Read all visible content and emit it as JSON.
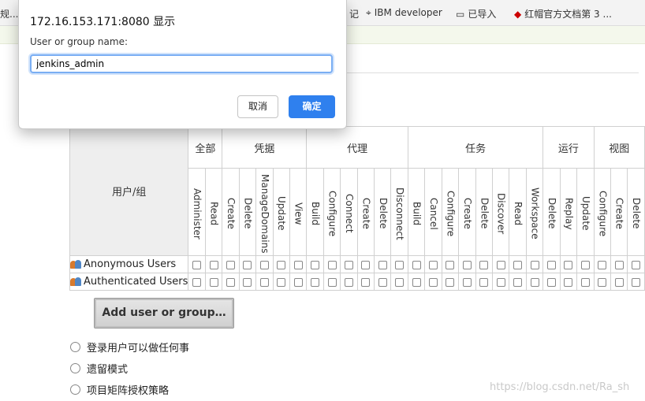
{
  "bookmarks": [
    {
      "text": "规...",
      "icon": ""
    },
    {
      "text": "记",
      "icon": ""
    },
    {
      "text": "IBM developer",
      "icon": "ibm-logo-icon"
    },
    {
      "text": "已导入",
      "icon": "folder-icon"
    },
    {
      "text": "红帽官方文档第 3 ...",
      "icon": "redhat-logo-icon"
    }
  ],
  "dialog": {
    "title": "172.16.153.171:8080 显示",
    "label": "User or group name:",
    "input_value": "jenkins_admin",
    "cancel_label": "取消",
    "ok_label": "确定"
  },
  "matrix": {
    "corner_label": "用户/组",
    "groups": [
      {
        "label": "全部",
        "permissions": [
          "Administer",
          "Read"
        ]
      },
      {
        "label": "凭据",
        "permissions": [
          "Create",
          "Delete",
          "ManageDomains",
          "Update",
          "View"
        ]
      },
      {
        "label": "代理",
        "permissions": [
          "Build",
          "Configure",
          "Connect",
          "Create",
          "Delete",
          "Disconnect"
        ]
      },
      {
        "label": "任务",
        "permissions": [
          "Build",
          "Cancel",
          "Configure",
          "Create",
          "Delete",
          "Discover",
          "Read",
          "Workspace"
        ]
      },
      {
        "label": "运行",
        "permissions": [
          "Delete",
          "Replay",
          "Update"
        ]
      },
      {
        "label": "视图",
        "permissions": [
          "Configure",
          "Create",
          "Delete"
        ]
      }
    ],
    "rows": [
      {
        "name": "Anonymous Users",
        "icon": "users-group-icon"
      },
      {
        "name": "Authenticated Users",
        "icon": "users-group-icon"
      }
    ]
  },
  "add_button_label": "Add user or group…",
  "strategies": [
    "登录用户可以做任何事",
    "遗留模式",
    "项目矩阵授权策略"
  ],
  "watermark": "https://blog.csdn.net/Ra_sh",
  "colors": {
    "primary_button": "#2f80ee",
    "input_focus": "#7aaef3"
  }
}
